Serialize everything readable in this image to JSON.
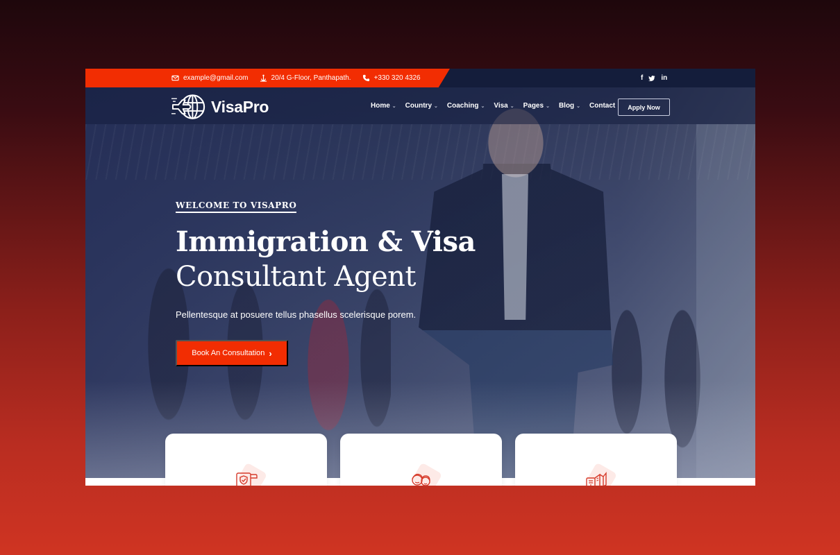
{
  "topbar": {
    "contacts": [
      {
        "icon": "envelope-icon",
        "text": "example@gmail.com"
      },
      {
        "icon": "location-anchor-icon",
        "text": "20/4 G-Floor, Panthapath."
      },
      {
        "icon": "phone-icon",
        "text": "+330 320 4326"
      }
    ],
    "socials": [
      {
        "icon": "facebook-icon",
        "glyph": "f"
      },
      {
        "icon": "twitter-icon",
        "glyph": "🐦"
      },
      {
        "icon": "linkedin-icon",
        "glyph": "in"
      }
    ]
  },
  "header": {
    "brand": "VisaPro",
    "nav": [
      {
        "label": "Home",
        "dropdown": true
      },
      {
        "label": "Country",
        "dropdown": true
      },
      {
        "label": "Coaching",
        "dropdown": true
      },
      {
        "label": "Visa",
        "dropdown": true
      },
      {
        "label": "Pages",
        "dropdown": true
      },
      {
        "label": "Blog",
        "dropdown": true
      },
      {
        "label": "Contact",
        "dropdown": false
      }
    ],
    "apply_label": "Apply Now"
  },
  "hero": {
    "eyebrow": "WELCOME TO VISAPRO",
    "title_line1": "Immigration & Visa",
    "title_line2": "Consultant Agent",
    "subtitle": "Pellentesque at posuere tellus phasellus scelerisque porem.",
    "cta_label": "Book An Consultation",
    "cta_arrow": "›"
  },
  "cards": [
    {
      "icon": "visa-document-shield-icon"
    },
    {
      "icon": "family-people-icon"
    },
    {
      "icon": "passport-book-icon"
    }
  ],
  "colors": {
    "accent": "#f22d02",
    "navy": "#141d3b",
    "background_top": "#1e070c",
    "background_bottom": "#cf3422"
  }
}
